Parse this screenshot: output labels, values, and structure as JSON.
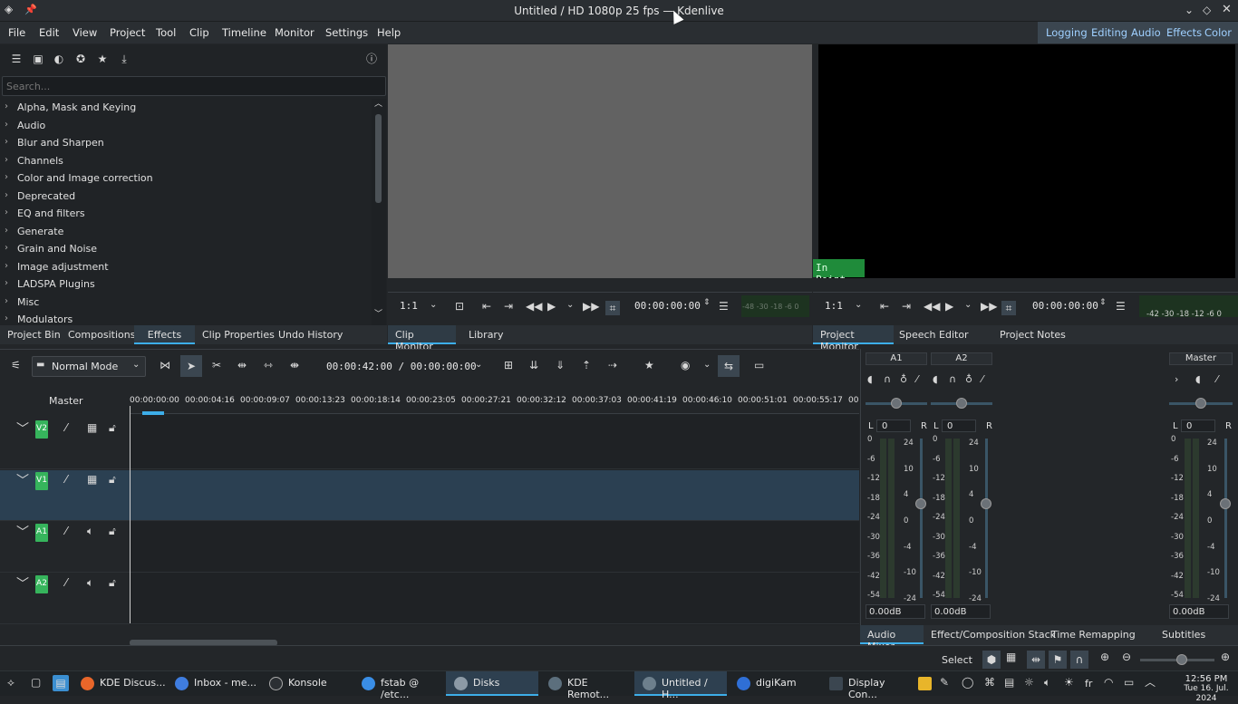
{
  "window": {
    "title": "Untitled / HD 1080p 25 fps — Kdenlive"
  },
  "menu": [
    "File",
    "Edit",
    "View",
    "Project",
    "Tool",
    "Clip",
    "Timeline",
    "Monitor",
    "Settings",
    "Help"
  ],
  "workspaces": [
    "Logging",
    "Editing",
    "Audio",
    "Effects",
    "Color"
  ],
  "effects": {
    "search_placeholder": "Search...",
    "categories": [
      "Alpha, Mask and Keying",
      "Audio",
      "Blur and Sharpen",
      "Channels",
      "Color and Image correction",
      "Deprecated",
      "EQ and filters",
      "Generate",
      "Grain and Noise",
      "Image adjustment",
      "LADSPA Plugins",
      "Misc",
      "Modulators"
    ]
  },
  "left_tabs": [
    "Project Bin",
    "Compositions",
    "Effects",
    "Clip Properties",
    "Undo History"
  ],
  "monitor_tabs": [
    "Clip Monitor",
    "Library"
  ],
  "project_tabs": [
    "Project Monitor",
    "Speech Editor",
    "Project Notes"
  ],
  "clip_monitor": {
    "zoom": "1:1",
    "timecode": "00:00:00:00",
    "meter_scale": "-48 -30 -18 -6 0"
  },
  "project_monitor": {
    "zoom": "1:1",
    "timecode": "00:00:00:00",
    "meter_scale": "-42 -30 -18 -12 -6 0",
    "in_point": "In Point"
  },
  "timeline": {
    "mode": "Normal Mode",
    "timecode": "00:00:42:00 / 00:00:00:00",
    "master_label": "Master",
    "ruler": [
      "00:00:00:00",
      "00:00:04:16",
      "00:00:09:07",
      "00:00:13:23",
      "00:00:18:14",
      "00:00:23:05",
      "00:00:27:21",
      "00:00:32:12",
      "00:00:37:03",
      "00:00:41:19",
      "00:00:46:10",
      "00:00:51:01",
      "00:00:55:17",
      "00"
    ],
    "tracks": [
      {
        "name": "V2",
        "type": "video"
      },
      {
        "name": "V1",
        "type": "video"
      },
      {
        "name": "A1",
        "type": "audio"
      },
      {
        "name": "A2",
        "type": "audio"
      }
    ]
  },
  "mixer": {
    "channels": [
      {
        "name": "A1",
        "pan": "0",
        "db": "0.00dB"
      },
      {
        "name": "A2",
        "pan": "0",
        "db": "0.00dB"
      },
      {
        "name": "Master",
        "pan": "0",
        "db": "0.00dB"
      }
    ],
    "left_scale": [
      "0",
      "-6",
      "-12",
      "-18",
      "-24",
      "-30",
      "-36",
      "-42",
      "-54"
    ],
    "right_scale": [
      "24",
      "10",
      "4",
      "0",
      "-4",
      "-10",
      "-24"
    ],
    "l_label": "L",
    "r_label": "R"
  },
  "bottom_tabs": [
    "Audio Mixer",
    "Effect/Composition Stack",
    "Time Remapping",
    "Subtitles"
  ],
  "status": {
    "select": "Select"
  },
  "taskbar": [
    {
      "label": "KDE Discus...",
      "color": "#e8662a"
    },
    {
      "label": "Inbox - me...",
      "color": "#3f7de0"
    },
    {
      "label": "Konsole",
      "color": "#2b2f33"
    },
    {
      "label": "fstab @ /etc...",
      "color": "#3a8ee6"
    },
    {
      "label": "Disks",
      "color": "#8c9aa6"
    },
    {
      "label": "KDE Remot...",
      "color": "#5c6f7d"
    },
    {
      "label": "Untitled / H...",
      "color": "#6d7f8c"
    },
    {
      "label": "digiKam",
      "color": "#2f6fd6"
    },
    {
      "label": "Display Con...",
      "color": "#3b4650"
    }
  ],
  "clock": {
    "time": "12:56 PM",
    "date": "Tue 16. Jul. 2024"
  }
}
